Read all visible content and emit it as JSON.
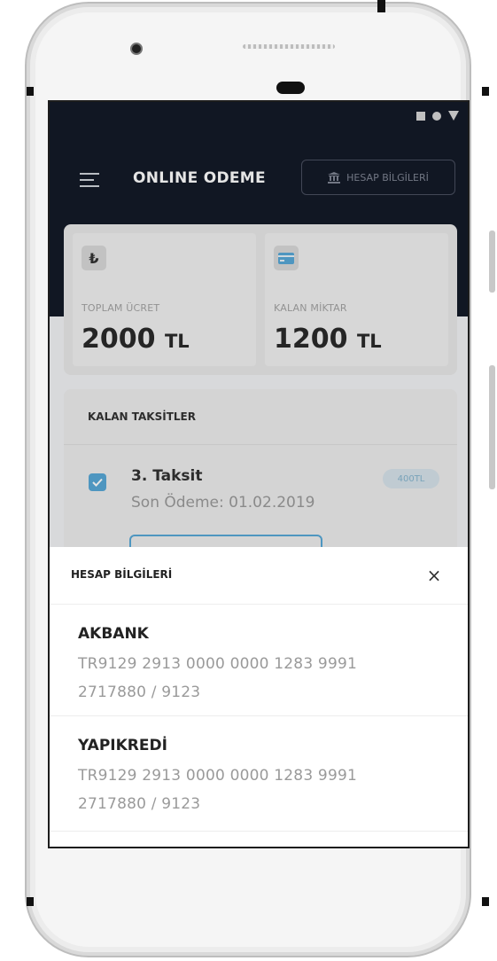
{
  "status_bar": {
    "icons": [
      "square-icon",
      "circle-icon",
      "triangle-icon"
    ]
  },
  "header": {
    "title": "ONLINE ODEME",
    "account_button_label": "HESAP BİLGİLERİ"
  },
  "summary": {
    "total": {
      "icon": "lira-icon",
      "label": "TOPLAM ÜCRET",
      "amount": "2000",
      "unit": "TL"
    },
    "remaining": {
      "icon": "card-icon",
      "label": "KALAN MİKTAR",
      "amount": "1200",
      "unit": "TL"
    }
  },
  "installments": {
    "title": "KALAN TAKSİTLER",
    "items": [
      {
        "name": "3. Taksit",
        "due": "Son Ödeme: 01.02.2019",
        "amount": "400TL",
        "checked": true
      }
    ]
  },
  "account_sheet": {
    "title": "HESAP BİLGİLERİ",
    "close_icon": "close-icon",
    "banks": [
      {
        "name": "AKBANK",
        "iban": "TR9129 2913 0000 0000 1283 9991",
        "account": "2717880 / 9123"
      },
      {
        "name": "YAPIKREDİ",
        "iban": "TR9129 2913 0000 0000 1283 9991",
        "account": "2717880 / 9123"
      }
    ]
  },
  "colors": {
    "header_bg": "#141a28",
    "accent": "#57a8d6",
    "sheet_bg": "#ffffff"
  }
}
